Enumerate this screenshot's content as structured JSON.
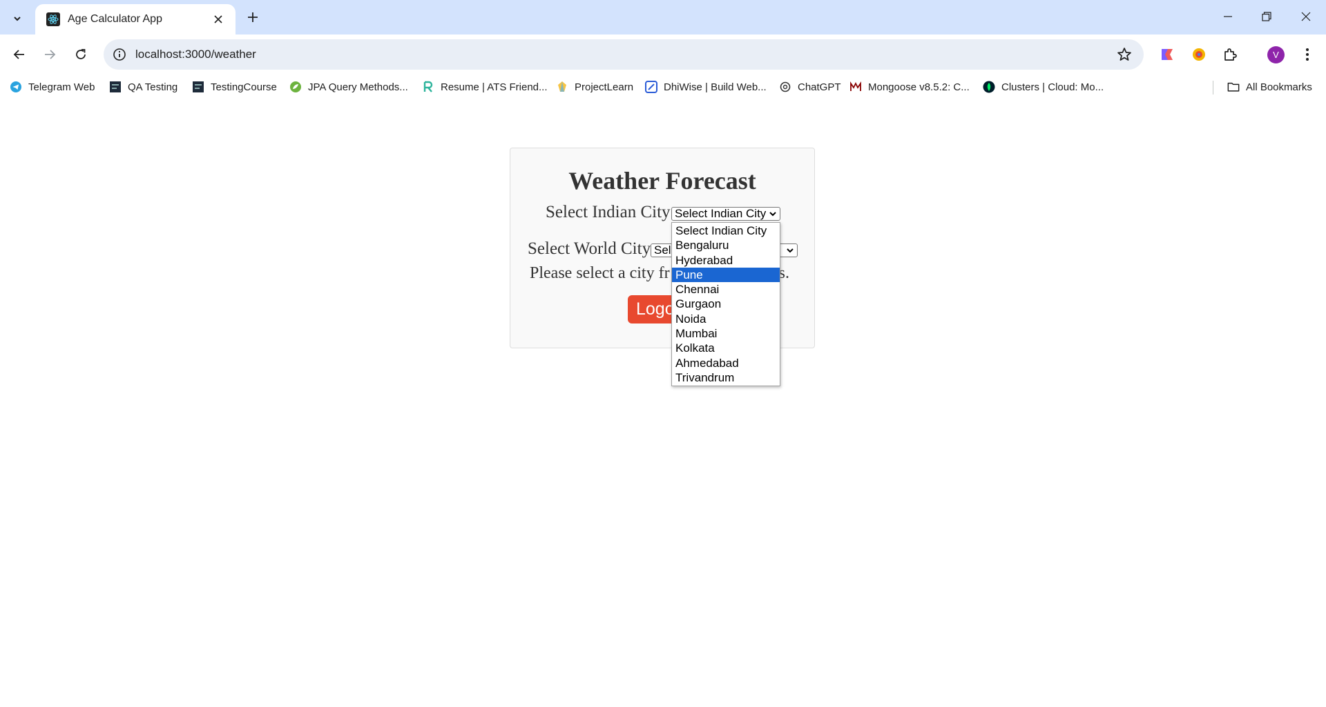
{
  "browser": {
    "tab_title": "Age Calculator App",
    "url": "localhost:3000/weather",
    "avatar_letter": "V",
    "bookmarks": [
      {
        "label": "Telegram Web",
        "icon": "telegram-icon"
      },
      {
        "label": "QA Testing",
        "icon": "page-icon"
      },
      {
        "label": "TestingCourse",
        "icon": "page-icon"
      },
      {
        "label": "JPA Query Methods...",
        "icon": "spring-leaf-icon"
      },
      {
        "label": "Resume | ATS Friend...",
        "icon": "resume-icon"
      },
      {
        "label": "ProjectLearn",
        "icon": "bulb-icon"
      },
      {
        "label": "DhiWise | Build Web...",
        "icon": "dhiwise-icon"
      },
      {
        "label": "ChatGPT",
        "icon": "chatgpt-icon"
      },
      {
        "label": "Mongoose v8.5.2: C...",
        "icon": "mongoose-icon"
      },
      {
        "label": "Clusters | Cloud: Mo...",
        "icon": "mongodb-leaf-icon"
      }
    ],
    "all_bookmarks_label": "All Bookmarks"
  },
  "page": {
    "title": "Weather Forecast",
    "indian_city_label": "Select Indian City",
    "indian_city_value": "Select Indian City",
    "world_city_label": "Select World City",
    "world_city_value": "Sel",
    "message": "Please select a city fr",
    "message_tail": "ts.",
    "logout_label": "Logout"
  },
  "dropdown": {
    "options": [
      "Select Indian City",
      "Bengaluru",
      "Hyderabad",
      "Pune",
      "Chennai",
      "Gurgaon",
      "Noida",
      "Mumbai",
      "Kolkata",
      "Ahmedabad",
      "Trivandrum"
    ],
    "highlighted": "Pune"
  },
  "colors": {
    "chrome_bg": "#d3e3fd",
    "omnibox_bg": "#e9eef6",
    "logout_bg": "#e8492f",
    "highlight": "#1a66d2",
    "avatar": "#8e24aa"
  }
}
